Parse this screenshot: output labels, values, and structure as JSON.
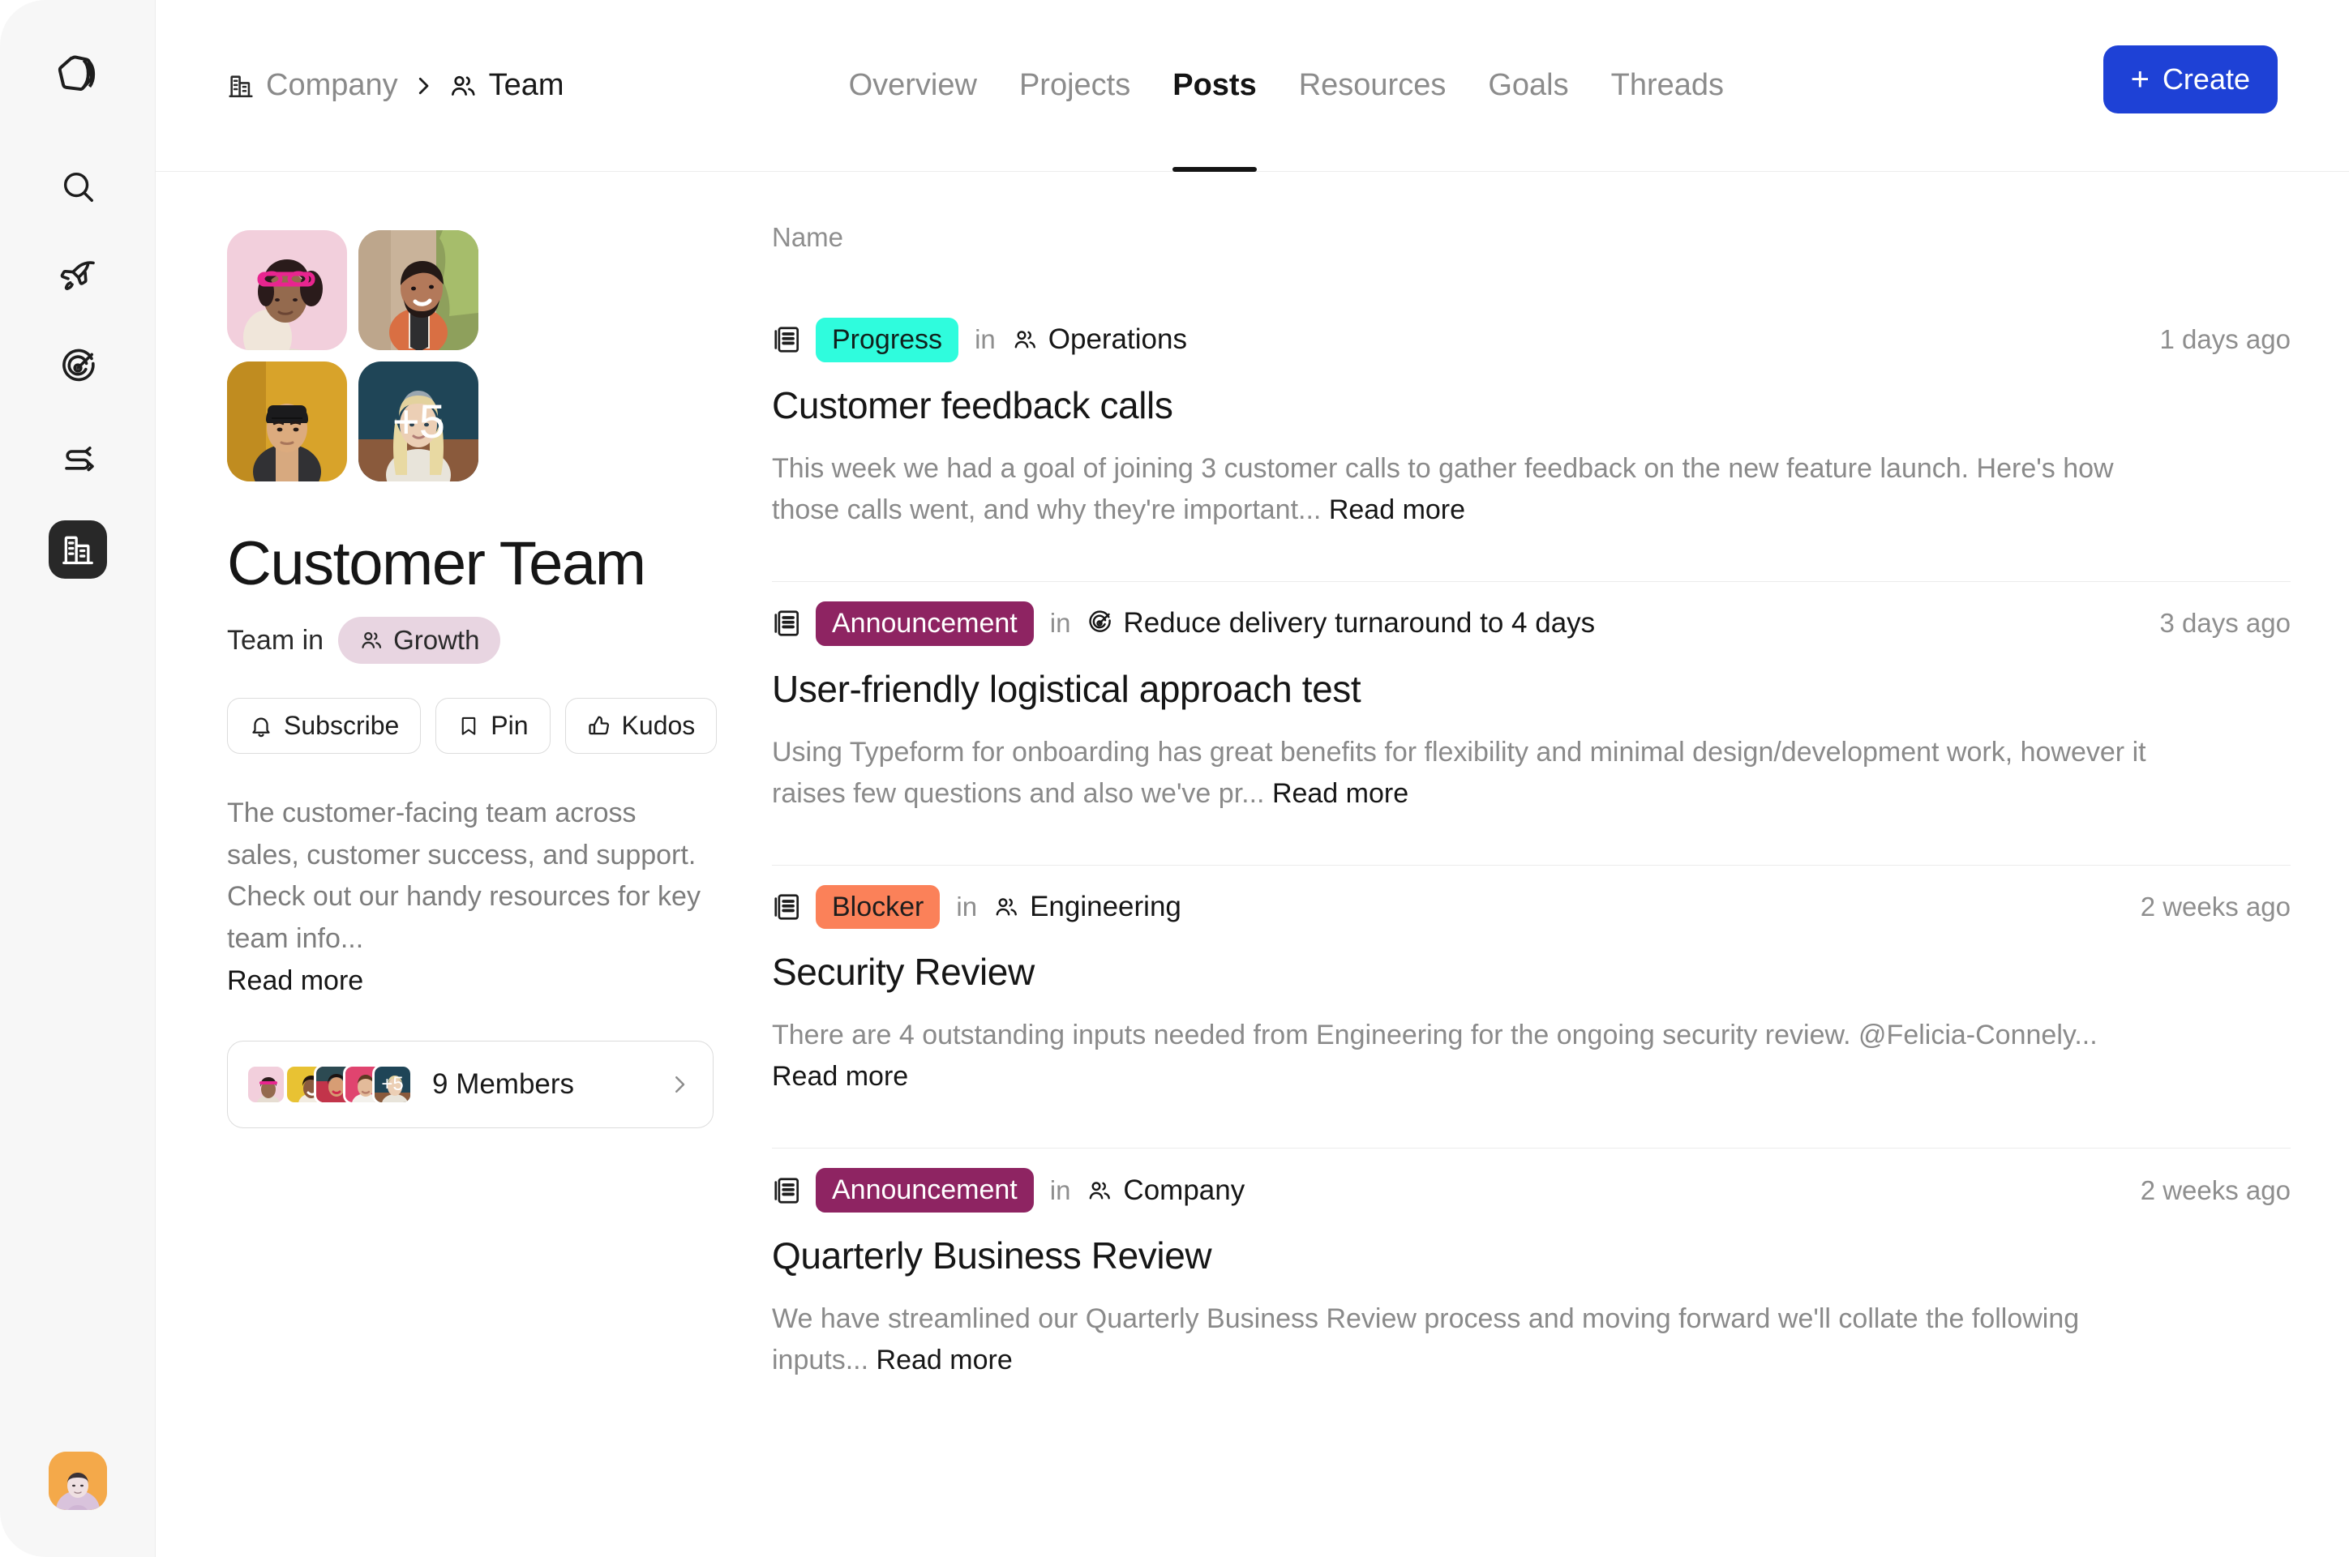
{
  "app": {
    "logo_icon": "cube-logo-icon",
    "accent_blue": "#1e41d6",
    "rail_active_bg": "#282828"
  },
  "sidebar": {
    "items": [
      {
        "name": "search",
        "icon": "search-icon",
        "active": false
      },
      {
        "name": "launch",
        "icon": "rocket-icon",
        "active": false
      },
      {
        "name": "goals",
        "icon": "target-icon",
        "active": false
      },
      {
        "name": "paths",
        "icon": "route-icon",
        "active": false
      },
      {
        "name": "company",
        "icon": "building-icon",
        "active": true
      }
    ],
    "avatar": {
      "name": "user-avatar",
      "bg": "#f4a94a"
    }
  },
  "header": {
    "breadcrumb": [
      {
        "label": "Company",
        "icon": "building-icon",
        "current": false
      },
      {
        "label": "Team",
        "icon": "people-icon",
        "current": true
      }
    ],
    "separator": "chevron-right-icon",
    "tabs": [
      {
        "label": "Overview",
        "active": false
      },
      {
        "label": "Projects",
        "active": false
      },
      {
        "label": "Posts",
        "active": true
      },
      {
        "label": "Resources",
        "active": false
      },
      {
        "label": "Goals",
        "active": false
      },
      {
        "label": "Threads",
        "active": false
      }
    ],
    "create_button": {
      "label": "Create",
      "plus": "+"
    }
  },
  "team": {
    "avatars": [
      {
        "bg": "#f2cfdc",
        "name": "team-member-avatar-1"
      },
      {
        "bg": "#c9b39a",
        "name": "team-member-avatar-2"
      },
      {
        "bg": "#d8a32a",
        "name": "team-member-avatar-3"
      },
      {
        "bg": "#1f4557",
        "name": "team-member-avatar-4",
        "overlay": "+5"
      }
    ],
    "title": "Customer Team",
    "subtitle_prefix": "Team in",
    "parent_pill": {
      "label": "Growth",
      "icon": "people-icon",
      "bg": "#e8d5e1"
    },
    "actions": [
      {
        "label": "Subscribe",
        "icon": "bell-icon"
      },
      {
        "label": "Pin",
        "icon": "bookmark-icon"
      },
      {
        "label": "Kudos",
        "icon": "thumbs-up-icon"
      }
    ],
    "description": "The customer-facing team across sales, customer success, and support. Check out our handy resources for key team info...",
    "description_read_more": "Read more",
    "members": {
      "label": "9 Members",
      "overflow": "+5",
      "chevron": "chevron-right-icon",
      "stack_colors": [
        "#f2cfdc",
        "#e8c233",
        "#c2344a",
        "#e0446f",
        "#1f4557"
      ]
    }
  },
  "posts": {
    "column_header": "Name",
    "items": [
      {
        "icon": "post-icon",
        "badge": {
          "label": "Progress",
          "bg": "#2ffcdd",
          "fg": "#10211d"
        },
        "in_label": "in",
        "context": {
          "label": "Operations",
          "icon": "people-icon"
        },
        "time": "1 days ago",
        "title": "Customer feedback calls",
        "body": "This week we had a goal of joining 3 customer calls to gather feedback on the new feature launch. Here's how those calls went, and why they're important...",
        "read_more": "Read more"
      },
      {
        "icon": "post-icon",
        "badge": {
          "label": "Announcement",
          "bg": "#8e2462",
          "fg": "#ffffff"
        },
        "in_label": "in",
        "context": {
          "label": "Reduce delivery turnaround to 4 days",
          "icon": "target-icon"
        },
        "time": "3 days ago",
        "title": "User-friendly logistical approach test",
        "body": "Using Typeform for onboarding has great benefits for flexibility and minimal design/development work, however it raises few questions and also we've pr...",
        "read_more": "Read more"
      },
      {
        "icon": "post-icon",
        "badge": {
          "label": "Blocker",
          "bg": "#fb8159",
          "fg": "#1d1d1d"
        },
        "in_label": "in",
        "context": {
          "label": "Engineering",
          "icon": "people-icon"
        },
        "time": "2 weeks ago",
        "title": "Security Review",
        "body": "There are 4 outstanding inputs needed from Engineering for the ongoing security review. @Felicia-Connely...",
        "read_more": "Read more"
      },
      {
        "icon": "post-icon",
        "badge": {
          "label": "Announcement",
          "bg": "#8e2462",
          "fg": "#ffffff"
        },
        "in_label": "in",
        "context": {
          "label": "Company",
          "icon": "people-icon"
        },
        "time": "2 weeks ago",
        "title": "Quarterly Business Review",
        "body": "We have streamlined our Quarterly Business Review process and moving forward we'll collate the following inputs...",
        "read_more": "Read more"
      }
    ]
  }
}
